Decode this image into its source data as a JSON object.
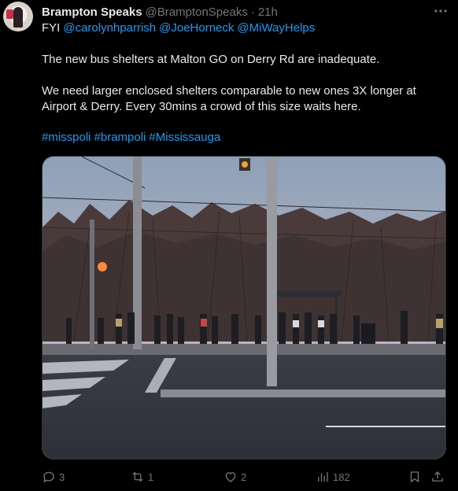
{
  "tweet": {
    "display_name": "Brampton Speaks",
    "handle": "@BramptonSpeaks",
    "separator": "·",
    "time": "21h",
    "more_icon": "more-horizontal-icon",
    "reply_prefix": "FYI",
    "mentions": [
      "@carolynhparrish",
      "@JoeHorneck",
      "@MiWayHelps"
    ],
    "paragraphs": [
      [
        "The new bus shelters at Malton GO on Derry Rd are inadequate."
      ],
      [
        "We need larger enclosed shelters comparable to new ones 3X longer at",
        "Airport & Derry. Every 30mins a crowd of this size waits here."
      ]
    ],
    "hashtags": [
      "#misspoli",
      "#brampoli",
      "#Mississauga"
    ]
  },
  "actions": {
    "reply": {
      "icon": "reply-icon",
      "count": "3"
    },
    "retweet": {
      "icon": "retweet-icon",
      "count": "1"
    },
    "like": {
      "icon": "heart-icon",
      "count": "2"
    },
    "views": {
      "icon": "views-chart-icon",
      "count": "182"
    },
    "bookmark": {
      "icon": "bookmark-icon"
    },
    "share": {
      "icon": "share-icon"
    }
  },
  "colors": {
    "background": "#000000",
    "text": "#e7e9ea",
    "muted": "#71767b",
    "link": "#1d9bf0",
    "border": "#2f3336"
  }
}
